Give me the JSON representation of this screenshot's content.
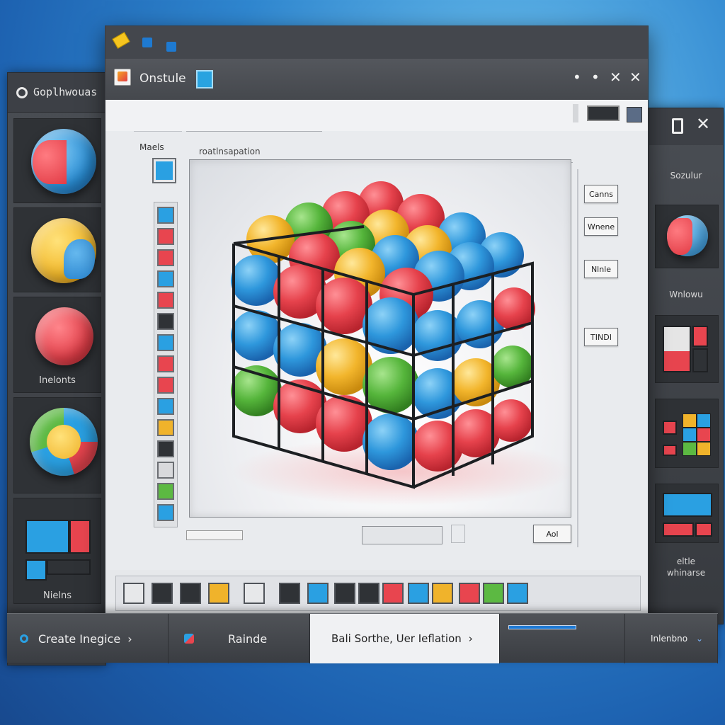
{
  "left_window": {
    "title": "Goplhwouas",
    "panels": [
      {
        "label": ""
      },
      {
        "label": ""
      },
      {
        "label": "Inelonts"
      },
      {
        "label": ""
      },
      {
        "label": "Nielns"
      }
    ]
  },
  "main_window": {
    "title": "Onstule",
    "controls": {
      "minimize": "•",
      "maximize": "•",
      "close1": "✕",
      "close2": "✕"
    },
    "side_label": "Maels",
    "viewport_label": "roatlnsapation",
    "properties": {
      "buttons": [
        "Canns",
        "Wnene",
        "Nlnle",
        "TINDI"
      ]
    },
    "bottom_button": "Aol"
  },
  "right_window": {
    "close": "✕",
    "labels": [
      "Sozulur",
      "Wnlowu",
      "eltle\nwhinarse"
    ]
  },
  "taskbar": {
    "items": [
      {
        "label": "Create  Inegice",
        "chevron": "›"
      },
      {
        "label": "Rainde"
      },
      {
        "label": "Bali Sorthe, Uer Ieflation",
        "chevron": "›"
      },
      {
        "label": "Inlenbno",
        "chevron": "⌄"
      }
    ]
  },
  "palette": {
    "swatches": [
      "#e7e8ea",
      "#2f3236",
      "#2f3236",
      "#f0b32b",
      "#e7e8ea",
      "#2f3236",
      "#2aa0e2",
      "#2f3236",
      "#2f3236",
      "#e8454f",
      "#2aa0e2",
      "#f0b32b",
      "#e8454f",
      "#5cb942",
      "#2aa0e2"
    ]
  },
  "side_swatches": [
    "#2aa0e2",
    "#e8454f",
    "#e8454f",
    "#2aa0e2",
    "#e8454f",
    "#2f3236",
    "#2aa0e2",
    "#e8454f",
    "#e8454f",
    "#2aa0e2",
    "#f0b32b",
    "#2f3236",
    "#d8d9dc",
    "#5cb942",
    "#2aa0e2"
  ],
  "colors": {
    "red": "#e8454f",
    "blue": "#2aa0e2",
    "green": "#5cb942",
    "yellow": "#f0b32b",
    "dark": "#2f3236"
  }
}
